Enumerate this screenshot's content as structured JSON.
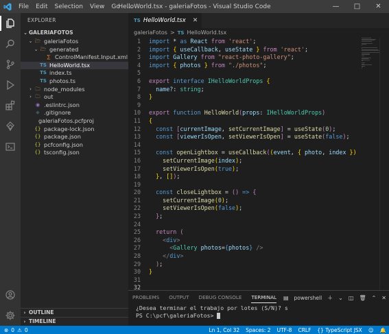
{
  "titlebar": {
    "menu": [
      "File",
      "Edit",
      "Selection",
      "View",
      "Go",
      "..."
    ],
    "title": "HelloWorld.tsx - galeriaFotos - Visual Studio Code"
  },
  "sidebar": {
    "header": "EXPLORER",
    "root": "GALERIAFOTOS",
    "tree": [
      {
        "label": "galeriaFotos",
        "depth": 1,
        "kind": "folder-open"
      },
      {
        "label": "generated",
        "depth": 2,
        "kind": "folder-open"
      },
      {
        "label": "ControlManifest.Input.xml",
        "depth": 3,
        "kind": "xml"
      },
      {
        "label": "HelloWorld.tsx",
        "depth": 2,
        "kind": "ts",
        "selected": true
      },
      {
        "label": "index.ts",
        "depth": 2,
        "kind": "ts"
      },
      {
        "label": "photos.ts",
        "depth": 2,
        "kind": "ts"
      },
      {
        "label": "node_modules",
        "depth": 1,
        "kind": "folder"
      },
      {
        "label": "out",
        "depth": 1,
        "kind": "folder"
      },
      {
        "label": ".eslintrc.json",
        "depth": 1,
        "kind": "eslint"
      },
      {
        "label": ".gitignore",
        "depth": 1,
        "kind": "git"
      },
      {
        "label": "galeriaFotos.pcfproj",
        "depth": 0,
        "kind": "file"
      },
      {
        "label": "package-lock.json",
        "depth": 1,
        "kind": "json"
      },
      {
        "label": "package.json",
        "depth": 1,
        "kind": "json"
      },
      {
        "label": "pcfconfig.json",
        "depth": 1,
        "kind": "json"
      },
      {
        "label": "tsconfig.json",
        "depth": 1,
        "kind": "json"
      }
    ],
    "outline": "OUTLINE",
    "timeline": "TIMELINE"
  },
  "editor": {
    "tab_icon": "TS",
    "tab_label": "HelloWorld.tsx",
    "breadcrumb_folder": "galeriaFotos",
    "breadcrumb_sep": ">",
    "breadcrumb_file": "HelloWorld.tsx",
    "current_line": 32,
    "lines": [
      [
        [
          "k",
          "import"
        ],
        [
          "p",
          " * "
        ],
        [
          "k",
          "as"
        ],
        [
          "v",
          " React "
        ],
        [
          "c",
          "from"
        ],
        [
          "s",
          " 'react'"
        ],
        [
          "p",
          ";"
        ]
      ],
      [
        [
          "k",
          "import"
        ],
        [
          "p",
          " "
        ],
        [
          "b",
          "{"
        ],
        [
          "v",
          " useCallback"
        ],
        [
          "p",
          ", "
        ],
        [
          "v",
          "useState "
        ],
        [
          "b",
          "}"
        ],
        [
          "c",
          " from"
        ],
        [
          "s",
          " 'react'"
        ],
        [
          "p",
          ";"
        ]
      ],
      [
        [
          "k",
          "import"
        ],
        [
          "v",
          " Gallery "
        ],
        [
          "c",
          "from"
        ],
        [
          "s",
          " \"react-photo-gallery\""
        ],
        [
          "p",
          ";"
        ]
      ],
      [
        [
          "k",
          "import"
        ],
        [
          "p",
          " "
        ],
        [
          "b",
          "{"
        ],
        [
          "v",
          " photos "
        ],
        [
          "b",
          "}"
        ],
        [
          "c",
          " from"
        ],
        [
          "s",
          " \"./photos\""
        ],
        [
          "p",
          ";"
        ]
      ],
      [],
      [
        [
          "c",
          "export"
        ],
        [
          "k",
          " interface"
        ],
        [
          "t",
          " IHelloWorldProps"
        ],
        [
          "p",
          " "
        ],
        [
          "b",
          "{"
        ]
      ],
      [
        [
          "v",
          "  name?"
        ],
        [
          "p",
          ": "
        ],
        [
          "t",
          "string"
        ],
        [
          "p",
          ";"
        ]
      ],
      [
        [
          "b",
          "}"
        ]
      ],
      [],
      [
        [
          "c",
          "export"
        ],
        [
          "k",
          " function"
        ],
        [
          "f",
          " HelloWorld"
        ],
        [
          "c",
          "("
        ],
        [
          "v",
          "props"
        ],
        [
          "p",
          ": "
        ],
        [
          "t",
          "IHelloWorldProps"
        ],
        [
          "c",
          ")"
        ]
      ],
      [
        [
          "b",
          "{"
        ]
      ],
      [
        [
          "k",
          "  const"
        ],
        [
          "p",
          " "
        ],
        [
          "c",
          "["
        ],
        [
          "v",
          "currentImage"
        ],
        [
          "p",
          ", "
        ],
        [
          "f",
          "setCurrentImage"
        ],
        [
          "c",
          "]"
        ],
        [
          "p",
          " = "
        ],
        [
          "f",
          "useState"
        ],
        [
          "c",
          "("
        ],
        [
          "n",
          "0"
        ],
        [
          "c",
          ")"
        ],
        [
          "p",
          ";"
        ]
      ],
      [
        [
          "k",
          "  const"
        ],
        [
          "p",
          " "
        ],
        [
          "c",
          "["
        ],
        [
          "v",
          "viewerIsOpen"
        ],
        [
          "p",
          ", "
        ],
        [
          "f",
          "setViewerIsOpen"
        ],
        [
          "c",
          "]"
        ],
        [
          "p",
          " = "
        ],
        [
          "f",
          "useState"
        ],
        [
          "c",
          "("
        ],
        [
          "k",
          "false"
        ],
        [
          "c",
          ")"
        ],
        [
          "p",
          ";"
        ]
      ],
      [],
      [
        [
          "k",
          "  const"
        ],
        [
          "f",
          " openLightbox"
        ],
        [
          "p",
          " = "
        ],
        [
          "f",
          "useCallback"
        ],
        [
          "c",
          "("
        ],
        [
          "b",
          "("
        ],
        [
          "v",
          "event"
        ],
        [
          "p",
          ", "
        ],
        [
          "b",
          "{"
        ],
        [
          "v",
          " photo"
        ],
        [
          "p",
          ", "
        ],
        [
          "v",
          "index "
        ],
        [
          "b",
          "}"
        ],
        [
          "b",
          ")"
        ]
      ],
      [
        [
          "f",
          "    setCurrentImage"
        ],
        [
          "b",
          "("
        ],
        [
          "v",
          "index"
        ],
        [
          "b",
          ")"
        ],
        [
          "p",
          ";"
        ]
      ],
      [
        [
          "f",
          "    setViewerIsOpen"
        ],
        [
          "b",
          "("
        ],
        [
          "k",
          "true"
        ],
        [
          "b",
          ")"
        ],
        [
          "p",
          ";"
        ]
      ],
      [
        [
          "p",
          "  "
        ],
        [
          "b",
          "}"
        ],
        [
          "p",
          ", "
        ],
        [
          "b",
          "[]"
        ],
        [
          "c",
          ")"
        ],
        [
          "p",
          ";"
        ]
      ],
      [],
      [
        [
          "k",
          "  const"
        ],
        [
          "f",
          " closeLightbox"
        ],
        [
          "p",
          " = "
        ],
        [
          "c",
          "()"
        ],
        [
          "k",
          " =>"
        ],
        [
          "p",
          " "
        ],
        [
          "c",
          "{"
        ]
      ],
      [
        [
          "f",
          "    setCurrentImage"
        ],
        [
          "b",
          "("
        ],
        [
          "n",
          "0"
        ],
        [
          "b",
          ")"
        ],
        [
          "p",
          ";"
        ]
      ],
      [
        [
          "f",
          "    setViewerIsOpen"
        ],
        [
          "b",
          "("
        ],
        [
          "k",
          "false"
        ],
        [
          "b",
          ")"
        ],
        [
          "p",
          ";"
        ]
      ],
      [
        [
          "p",
          "  "
        ],
        [
          "c",
          "}"
        ],
        [
          "p",
          ";"
        ]
      ],
      [],
      [
        [
          "c",
          "  return"
        ],
        [
          "p",
          " "
        ],
        [
          "c",
          "("
        ]
      ],
      [
        [
          "g",
          "    <"
        ],
        [
          "tag",
          "div"
        ],
        [
          "g",
          ">"
        ]
      ],
      [
        [
          "g",
          "      <"
        ],
        [
          "t",
          "Gallery"
        ],
        [
          "v",
          " photos"
        ],
        [
          "p",
          "="
        ],
        [
          "k",
          "{"
        ],
        [
          "v",
          "photos"
        ],
        [
          "k",
          "}"
        ],
        [
          "g",
          " />"
        ]
      ],
      [
        [
          "g",
          "    </"
        ],
        [
          "tag",
          "div"
        ],
        [
          "g",
          ">"
        ]
      ],
      [
        [
          "p",
          "  "
        ],
        [
          "c",
          ")"
        ],
        [
          "p",
          ";"
        ]
      ],
      [
        [
          "b",
          "}"
        ]
      ],
      [],
      []
    ]
  },
  "panel": {
    "tabs": [
      "PROBLEMS",
      "OUTPUT",
      "DEBUG CONSOLE",
      "TERMINAL"
    ],
    "active_tab": "TERMINAL",
    "shell": "powershell",
    "terminal_lines": [
      "¿Desea terminar el trabajo por lotes (S/N)? s",
      "PS C:\\pcf\\galeriaFotos> "
    ]
  },
  "statusbar": {
    "errors": "0",
    "warnings": "0",
    "position": "Ln 1, Col 32",
    "spaces": "Spaces: 2",
    "encoding": "UTF-8",
    "eol": "CRLF",
    "language": "TypeScript JSX"
  },
  "colors": {
    "accent": "#007acc",
    "ts_icon": "#519aba",
    "json_icon": "#cbcb41",
    "xml_icon": "#e37933",
    "folder": "#c09553"
  }
}
